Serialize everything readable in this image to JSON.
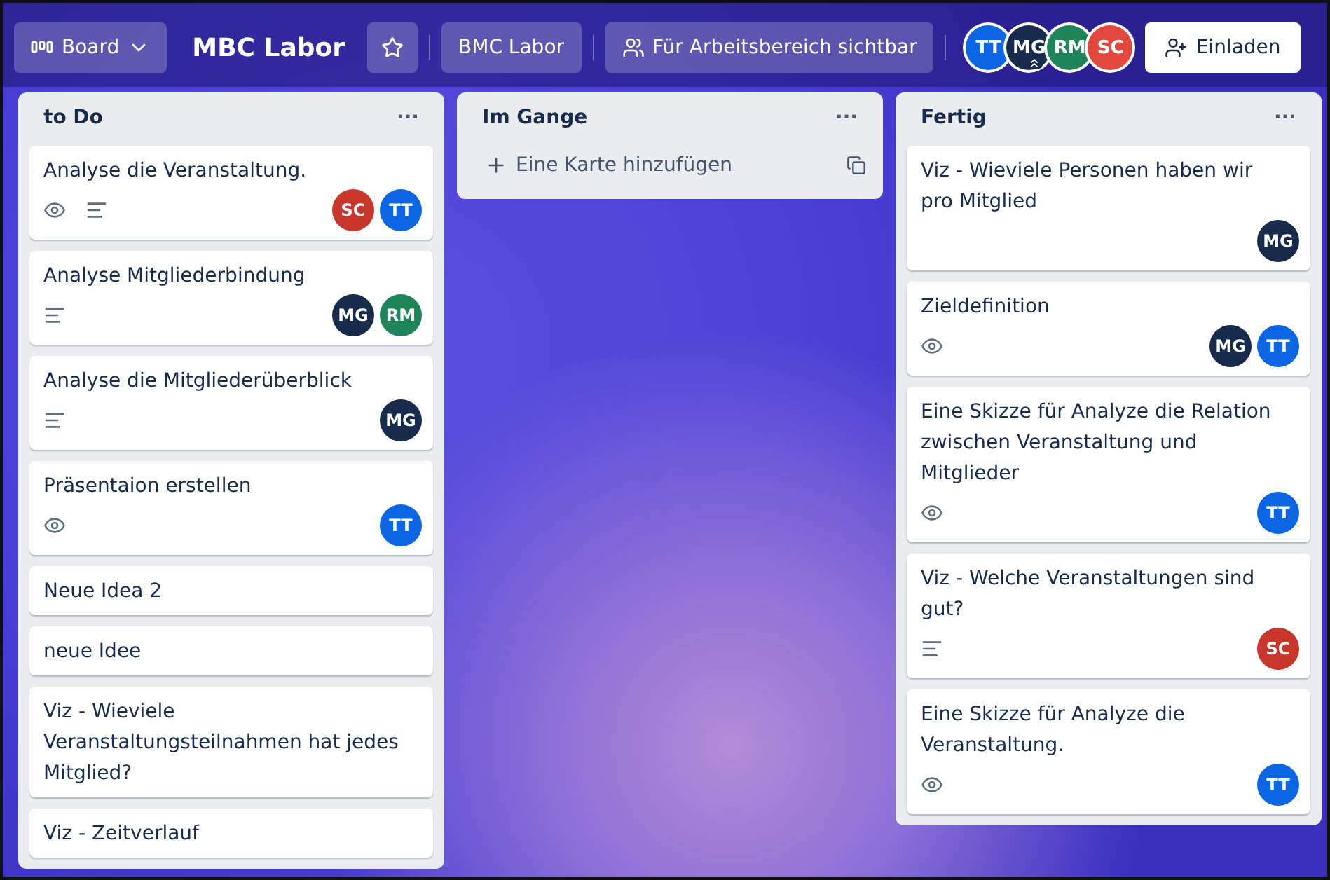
{
  "header": {
    "view_switcher": {
      "label": "Board"
    },
    "board_title": "MBC Labor",
    "starred": false,
    "workspace_button": "BMC Labor",
    "visibility_button": "Für Arbeitsbereich sichtbar",
    "members": [
      {
        "initials": "TT",
        "color": "#0c66e4",
        "admin": false
      },
      {
        "initials": "MG",
        "color": "#172b4d",
        "admin": true
      },
      {
        "initials": "RM",
        "color": "#1f845a",
        "admin": false
      },
      {
        "initials": "SC",
        "color": "#e2483d",
        "admin": false
      }
    ],
    "invite_button": "Einladen"
  },
  "lists": [
    {
      "title": "to Do",
      "menu": "···",
      "cards": [
        {
          "title": "Analyse die Veranstaltung.",
          "badges": [
            {
              "kind": "watch"
            },
            {
              "kind": "description"
            }
          ],
          "members": [
            {
              "initials": "SC",
              "color": "#c9372c"
            },
            {
              "initials": "TT",
              "color": "#0c66e4"
            }
          ]
        },
        {
          "title": "Analyse Mitgliederbindung",
          "badges": [
            {
              "kind": "description"
            }
          ],
          "members": [
            {
              "initials": "MG",
              "color": "#172b4d"
            },
            {
              "initials": "RM",
              "color": "#1f845a"
            }
          ]
        },
        {
          "title": "Analyse die Mitgliederüberblick",
          "badges": [
            {
              "kind": "description"
            }
          ],
          "members": [
            {
              "initials": "MG",
              "color": "#172b4d"
            }
          ]
        },
        {
          "title": "Präsentaion erstellen",
          "badges": [
            {
              "kind": "watch"
            }
          ],
          "members": [
            {
              "initials": "TT",
              "color": "#0c66e4"
            }
          ]
        },
        {
          "title": "Neue Idea 2"
        },
        {
          "title": "neue Idee"
        },
        {
          "title": "Viz - Wieviele Veranstaltungsteilnahmen hat jedes Mitglied?"
        },
        {
          "title": "Viz - Zeitverlauf"
        }
      ]
    },
    {
      "title": "Im Gange",
      "menu": "···",
      "add_card": "Eine Karte hinzufügen"
    },
    {
      "title": "Fertig",
      "menu": "···",
      "cards": [
        {
          "title": "Viz - Wieviele Personen haben wir pro Mitglied",
          "members": [
            {
              "initials": "MG",
              "color": "#172b4d"
            }
          ]
        },
        {
          "title": "Zieldefinition",
          "badges": [
            {
              "kind": "watch"
            }
          ],
          "members": [
            {
              "initials": "MG",
              "color": "#172b4d"
            },
            {
              "initials": "TT",
              "color": "#0c66e4"
            }
          ]
        },
        {
          "title": "Eine Skizze für Analyze die Relation zwischen Veranstaltung und Mitglieder",
          "badges": [
            {
              "kind": "watch"
            }
          ],
          "members": [
            {
              "initials": "TT",
              "color": "#0c66e4"
            }
          ]
        },
        {
          "title": "Viz - Welche Veranstaltungen sind gut?",
          "badges": [
            {
              "kind": "description"
            }
          ],
          "members": [
            {
              "initials": "SC",
              "color": "#c9372c"
            }
          ]
        },
        {
          "title": "Eine Skizze für Analyze die Veranstaltung.",
          "badges": [
            {
              "kind": "watch"
            }
          ],
          "members": [
            {
              "initials": "TT",
              "color": "#0c66e4"
            }
          ]
        }
      ]
    }
  ]
}
